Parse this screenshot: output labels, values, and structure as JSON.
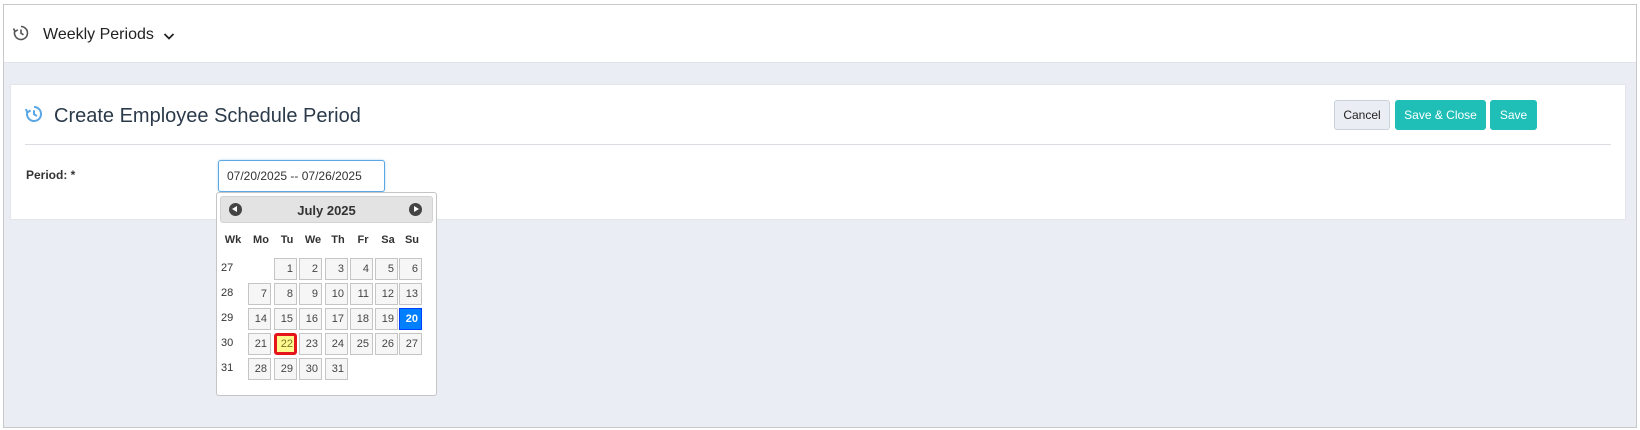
{
  "topbar": {
    "title": "Weekly Periods",
    "icon": "history-icon"
  },
  "panel": {
    "title": "Create Employee Schedule Period",
    "buttons": {
      "cancel": "Cancel",
      "save_close": "Save & Close",
      "save": "Save"
    },
    "period_label": "Period: *",
    "period_value": "07/20/2025 -- 07/26/2025"
  },
  "datepicker": {
    "month": "July 2025",
    "dow": [
      "Wk",
      "Mo",
      "Tu",
      "We",
      "Th",
      "Fr",
      "Sa",
      "Su"
    ],
    "weeks": [
      {
        "wk": "27",
        "days": [
          "",
          "1",
          "2",
          "3",
          "4",
          "5",
          "6"
        ]
      },
      {
        "wk": "28",
        "days": [
          "7",
          "8",
          "9",
          "10",
          "11",
          "12",
          "13"
        ]
      },
      {
        "wk": "29",
        "days": [
          "14",
          "15",
          "16",
          "17",
          "18",
          "19",
          "20"
        ]
      },
      {
        "wk": "30",
        "days": [
          "21",
          "22",
          "23",
          "24",
          "25",
          "26",
          "27"
        ]
      },
      {
        "wk": "31",
        "days": [
          "28",
          "29",
          "30",
          "31",
          "",
          "",
          ""
        ]
      }
    ],
    "selected_day": "20",
    "highlighted_day": "22"
  },
  "colors": {
    "accent": "#1fbfb8",
    "selected": "#007fff",
    "highlight": "#fffa90",
    "highlight_border": "#e5161b"
  }
}
